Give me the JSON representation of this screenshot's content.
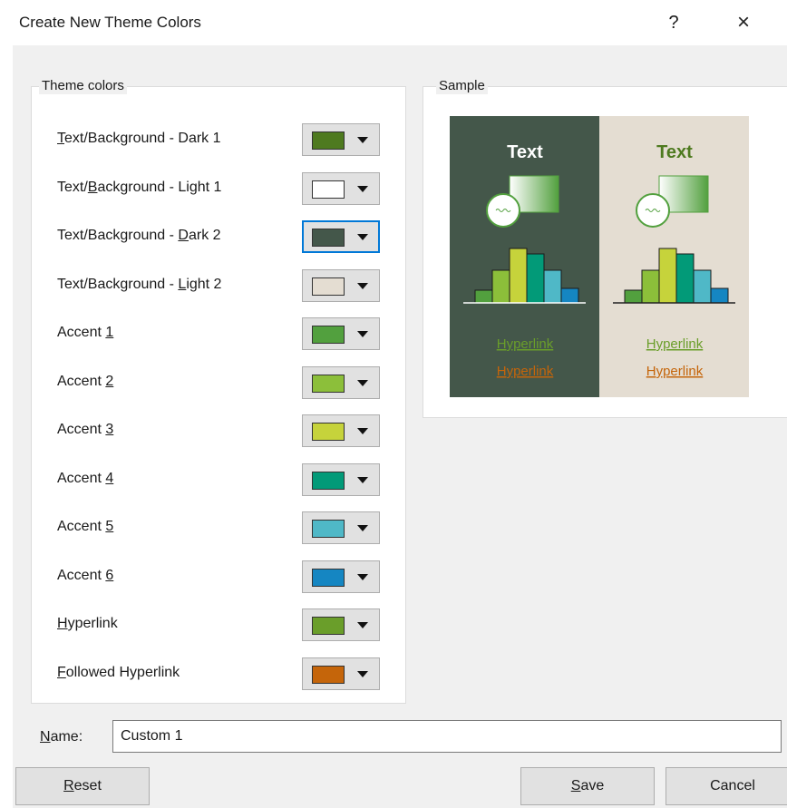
{
  "window": {
    "title": "Create New Theme Colors",
    "help_label": "?",
    "close_label": "×"
  },
  "theme_colors": {
    "legend": "Theme colors",
    "rows": [
      {
        "pre": "",
        "key": "T",
        "post": "ext/Background - Dark 1",
        "color": "#4e7a1f"
      },
      {
        "pre": "Text/",
        "key": "B",
        "post": "ackground - Light 1",
        "color": "#ffffff"
      },
      {
        "pre": "Text/Background - ",
        "key": "D",
        "post": "ark 2",
        "color": "#44574a"
      },
      {
        "pre": "Text/Background - ",
        "key": "L",
        "post": "ight 2",
        "color": "#e4ddd2"
      },
      {
        "pre": "Accent ",
        "key": "1",
        "post": "",
        "color": "#52a03e"
      },
      {
        "pre": "Accent ",
        "key": "2",
        "post": "",
        "color": "#8cbf3a"
      },
      {
        "pre": "Accent ",
        "key": "3",
        "post": "",
        "color": "#c6d33b"
      },
      {
        "pre": "Accent ",
        "key": "4",
        "post": "",
        "color": "#029a78"
      },
      {
        "pre": "Accent ",
        "key": "5",
        "post": "",
        "color": "#4fb8c7"
      },
      {
        "pre": "Accent ",
        "key": "6",
        "post": "",
        "color": "#1586c2"
      },
      {
        "pre": "",
        "key": "H",
        "post": "yperlink",
        "color": "#6a9e2a"
      },
      {
        "pre": "",
        "key": "F",
        "post": "ollowed Hyperlink",
        "color": "#c5650a"
      }
    ],
    "focused_index": 2
  },
  "sample": {
    "legend": "Sample",
    "text_label": "Text",
    "hyperlink_label": "Hyperlink",
    "followed_hyperlink_label": "Hyperlink",
    "colors": {
      "dark_bg": "#44574a",
      "light_bg": "#e4ddd2",
      "light_text": "#ffffff",
      "dark_text": "#4e7a1f",
      "accents": [
        "#52a03e",
        "#8cbf3a",
        "#c6d33b",
        "#029a78",
        "#4fb8c7",
        "#1586c2"
      ],
      "hyperlink": "#6a9e2a",
      "followed": "#c5650a"
    }
  },
  "name": {
    "label_key": "N",
    "label_rest": "ame:",
    "value": "Custom 1"
  },
  "buttons": {
    "reset_key": "R",
    "reset_rest": "eset",
    "save_key": "S",
    "save_rest": "ave",
    "cancel_label": "Cancel"
  }
}
